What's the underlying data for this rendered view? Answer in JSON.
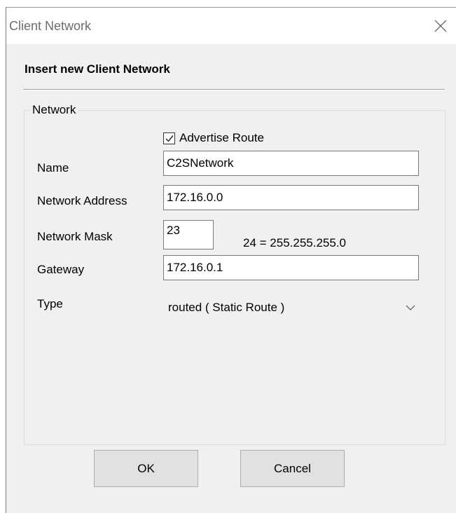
{
  "window": {
    "title": "Client Network"
  },
  "dialog": {
    "heading": "Insert new Client Network"
  },
  "network_group": {
    "legend": "Network",
    "advertise_route": {
      "label": "Advertise Route",
      "checked": true
    },
    "name": {
      "label": "Name",
      "value": "C2SNetwork"
    },
    "network_address": {
      "label": "Network Address",
      "value": "172.16.0.0"
    },
    "network_mask": {
      "label": "Network Mask",
      "value": "23",
      "hint": "24 = 255.255.255.0"
    },
    "gateway": {
      "label": "Gateway",
      "value": "172.16.0.1"
    },
    "type": {
      "label": "Type",
      "selected": "routed  ( Static Route )"
    }
  },
  "buttons": {
    "ok_label": "OK",
    "cancel_label": "Cancel"
  },
  "icons": {
    "close": "close-icon",
    "checkbox": "checkmark-icon",
    "dropdown": "chevron-down-icon"
  },
  "colors": {
    "dialog_bg": "#f0f0f0",
    "title_text": "#6d6d6d",
    "button_bg": "#e1e1e1",
    "field_border": "#7a7a7a"
  }
}
